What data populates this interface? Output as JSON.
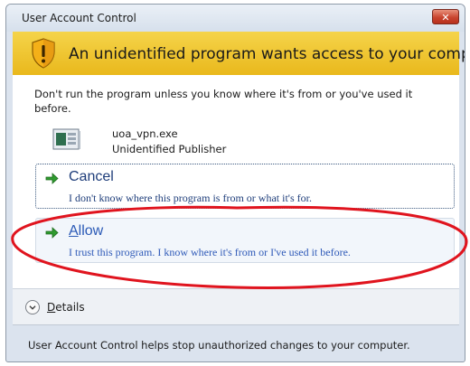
{
  "window": {
    "title": "User Account Control",
    "close_glyph": "✕"
  },
  "banner": {
    "icon": "shield-warning-icon",
    "heading": "An unidentified program wants access to your computer"
  },
  "warning": {
    "text": "Don't run the program unless you know where it's from or you've used it before."
  },
  "program": {
    "icon": "program-icon",
    "name": "uoa_vpn.exe",
    "publisher": "Unidentified Publisher"
  },
  "options": {
    "cancel": {
      "icon": "green-arrow-icon",
      "title": "Cancel",
      "description": "I don't know where this program is from or what it's for."
    },
    "allow": {
      "icon": "green-arrow-icon",
      "title_first": "A",
      "title_rest": "llow",
      "description": "I trust this program. I know where it's from or I've used it before."
    }
  },
  "details": {
    "icon": "chevron-down-circle-icon",
    "label_first": "D",
    "label_rest": "etails"
  },
  "footer": {
    "text": "User Account Control helps stop unauthorized changes to your computer."
  },
  "colors": {
    "banner": "#f0c72e",
    "link_blue": "#2a59b6",
    "annotation_red": "#e0141e"
  }
}
